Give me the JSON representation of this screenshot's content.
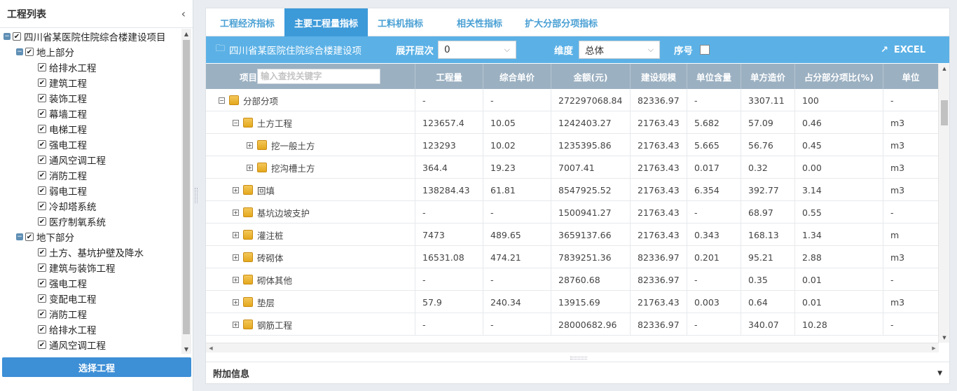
{
  "left_panel": {
    "title": "工程列表",
    "select_button": "选择工程",
    "tree": [
      {
        "level": 0,
        "label": "四川省某医院住院综合楼建设项目",
        "checked": true,
        "expander": "minus"
      },
      {
        "level": 1,
        "label": "地上部分",
        "checked": true,
        "expander": "minus"
      },
      {
        "level": 2,
        "label": "给排水工程",
        "checked": true
      },
      {
        "level": 2,
        "label": "建筑工程",
        "checked": true
      },
      {
        "level": 2,
        "label": "装饰工程",
        "checked": true
      },
      {
        "level": 2,
        "label": "幕墙工程",
        "checked": true
      },
      {
        "level": 2,
        "label": "电梯工程",
        "checked": true
      },
      {
        "level": 2,
        "label": "强电工程",
        "checked": true
      },
      {
        "level": 2,
        "label": "通风空调工程",
        "checked": true
      },
      {
        "level": 2,
        "label": "消防工程",
        "checked": true
      },
      {
        "level": 2,
        "label": "弱电工程",
        "checked": true
      },
      {
        "level": 2,
        "label": "冷却塔系统",
        "checked": true
      },
      {
        "level": 2,
        "label": "医疗制氧系统",
        "checked": true
      },
      {
        "level": 1,
        "label": "地下部分",
        "checked": true,
        "expander": "minus"
      },
      {
        "level": 2,
        "label": "土方、基坑护壁及降水",
        "checked": true
      },
      {
        "level": 2,
        "label": "建筑与装饰工程",
        "checked": true
      },
      {
        "level": 2,
        "label": "强电工程",
        "checked": true
      },
      {
        "level": 2,
        "label": "变配电工程",
        "checked": true
      },
      {
        "level": 2,
        "label": "消防工程",
        "checked": true
      },
      {
        "level": 2,
        "label": "给排水工程",
        "checked": true
      },
      {
        "level": 2,
        "label": "通风空调工程",
        "checked": true
      }
    ]
  },
  "tabs": [
    {
      "label": "工程经济指标",
      "active": false
    },
    {
      "label": "主要工程量指标",
      "active": true
    },
    {
      "label": "工料机指标",
      "active": false
    },
    {
      "label": "相关性指标",
      "active": false
    },
    {
      "label": "扩大分部分项指标",
      "active": false
    }
  ],
  "toolbar": {
    "project_name": "四川省某医院住院综合楼建设项",
    "expand_level_label": "展开层次",
    "expand_level_value": "0",
    "dimension_label": "维度",
    "dimension_value": "总体",
    "serial_label": "序号",
    "excel_label": "EXCEL"
  },
  "grid": {
    "columns": [
      "项目",
      "工程量",
      "综合单价",
      "金额(元)",
      "建设规模",
      "单位含量",
      "单方造价",
      "占分部分项比(%)",
      "单位"
    ],
    "search_placeholder": "输入查找关键字",
    "rows": [
      {
        "indent": 0,
        "expander": "⊟",
        "name": "分部分项",
        "cells": [
          "-",
          "-",
          "272297068.84",
          "82336.97",
          "-",
          "3307.11",
          "100",
          "-"
        ]
      },
      {
        "indent": 1,
        "expander": "⊟",
        "name": "土方工程",
        "cells": [
          "123657.4",
          "10.05",
          "1242403.27",
          "21763.43",
          "5.682",
          "57.09",
          "0.46",
          "m3"
        ]
      },
      {
        "indent": 2,
        "expander": "⊞",
        "name": "挖一般土方",
        "cells": [
          "123293",
          "10.02",
          "1235395.86",
          "21763.43",
          "5.665",
          "56.76",
          "0.45",
          "m3"
        ]
      },
      {
        "indent": 2,
        "expander": "⊞",
        "name": "挖沟槽土方",
        "cells": [
          "364.4",
          "19.23",
          "7007.41",
          "21763.43",
          "0.017",
          "0.32",
          "0.00",
          "m3"
        ]
      },
      {
        "indent": 1,
        "expander": "⊞",
        "name": "回填",
        "cells": [
          "138284.43",
          "61.81",
          "8547925.52",
          "21763.43",
          "6.354",
          "392.77",
          "3.14",
          "m3"
        ]
      },
      {
        "indent": 1,
        "expander": "⊞",
        "name": "基坑边坡支护",
        "cells": [
          "-",
          "-",
          "1500941.27",
          "21763.43",
          "-",
          "68.97",
          "0.55",
          "-"
        ]
      },
      {
        "indent": 1,
        "expander": "⊞",
        "name": "灌注桩",
        "cells": [
          "7473",
          "489.65",
          "3659137.66",
          "21763.43",
          "0.343",
          "168.13",
          "1.34",
          "m"
        ]
      },
      {
        "indent": 1,
        "expander": "⊞",
        "name": "砖砌体",
        "cells": [
          "16531.08",
          "474.21",
          "7839251.36",
          "82336.97",
          "0.201",
          "95.21",
          "2.88",
          "m3"
        ]
      },
      {
        "indent": 1,
        "expander": "⊞",
        "name": "砌体其他",
        "cells": [
          "-",
          "-",
          "28760.68",
          "82336.97",
          "-",
          "0.35",
          "0.01",
          "-"
        ]
      },
      {
        "indent": 1,
        "expander": "⊞",
        "name": "垫层",
        "cells": [
          "57.9",
          "240.34",
          "13915.69",
          "21763.43",
          "0.003",
          "0.64",
          "0.01",
          "m3"
        ]
      },
      {
        "indent": 1,
        "expander": "⊞",
        "name": "钢筋工程",
        "cells": [
          "-",
          "-",
          "28000682.96",
          "82336.97",
          "-",
          "340.07",
          "10.28",
          "-"
        ]
      }
    ]
  },
  "footer": {
    "title": "附加信息"
  }
}
